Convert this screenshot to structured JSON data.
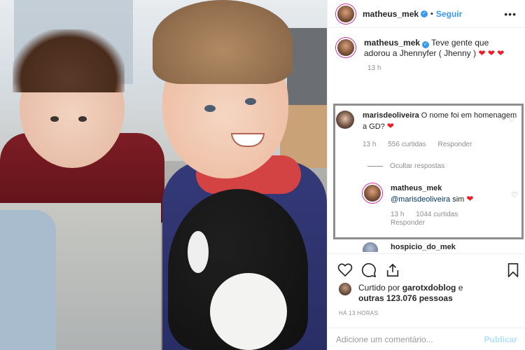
{
  "post": {
    "author": "matheus_mek",
    "follow_label": "Seguir",
    "more_label": "•••"
  },
  "caption": {
    "author": "matheus_mek",
    "text": "Teve gente que adorou a Jhennyfer ( Jhenny )",
    "time": "13 h"
  },
  "comments": [
    {
      "author": "marisdeoliveira",
      "text": "O nome foi em homenagem a GD?",
      "time": "13 h",
      "likes": "556 curtidas",
      "reply_label": "Responder"
    }
  ],
  "hide_replies_label": "Ocultar respostas",
  "reply": {
    "author": "matheus_mek",
    "mention": "@marisdeoliveira",
    "text": "sim",
    "time": "13 h",
    "likes": "1044 curtidas",
    "reply_label": "Responder"
  },
  "next_comment": {
    "author": "hospicio_do_mek"
  },
  "likes_summary": {
    "prefix": "Curtido por",
    "user": "garotxdoblog",
    "middle": "e",
    "others": "outras 123.076 pessoas"
  },
  "post_time": "HÁ 13 HORAS",
  "comment_box": {
    "placeholder": "Adicione um comentário...",
    "publish_label": "Publicar"
  },
  "icons": [
    "heart-icon",
    "comment-icon",
    "share-icon",
    "bookmark-icon"
  ],
  "colors": {
    "accent": "#3897f0",
    "heart": "#ed1c24",
    "muted": "#8e8e8e",
    "highlight_border": "#8e8e8e"
  }
}
